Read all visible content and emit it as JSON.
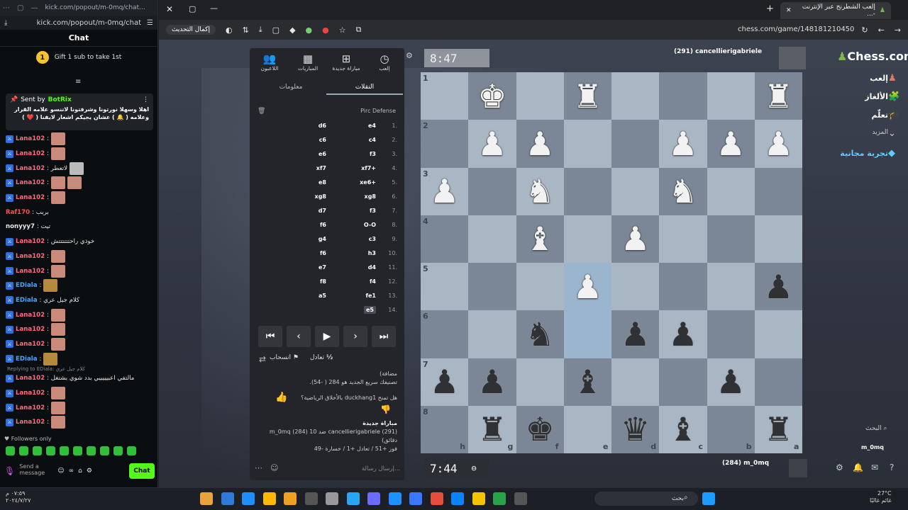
{
  "kick": {
    "url": "kick.com/popout/m-0mq/chat",
    "tab_url": "kick.com/popout/m-0mq/chat...",
    "chat_title": "Chat",
    "gift_rank": "1",
    "gift_text": "Gift 1 sub to take 1st",
    "pinned": {
      "sent_by": "Sent by",
      "author": "BotRix",
      "message": "اهلا وسهلا نورتونا وشرفتونا لاتنسو علامه القرار وعلامه ( 🔔 ) عشان يجيكم اشعار لايفنا ( ❤️ )"
    },
    "messages": [
      {
        "user": "Lana102",
        "text": ":",
        "style": "red",
        "mod": true,
        "emotes": [
          "e"
        ]
      },
      {
        "user": "Lana102",
        "text": ":",
        "style": "red",
        "mod": true,
        "emotes": [
          "e"
        ]
      },
      {
        "user": "Lana102",
        "text": ": لاتعطر",
        "style": "red",
        "mod": true,
        "emotes": [
          "g"
        ]
      },
      {
        "user": "Lana102",
        "text": ":",
        "style": "red",
        "mod": true,
        "emotes": [
          "e",
          "e"
        ]
      },
      {
        "user": "Lana102",
        "text": ":",
        "style": "red",
        "mod": true,
        "emotes": [
          "e"
        ]
      },
      {
        "user": "Raf170",
        "text": ": بربب",
        "style": "plain-red",
        "mod": false,
        "emotes": []
      },
      {
        "user": "nonyyy7",
        "text": ": تيت",
        "style": "plain",
        "mod": false,
        "emotes": []
      },
      {
        "user": "Lana102",
        "text": ": خوذي راحتتتتتتش",
        "style": "red",
        "mod": true,
        "emotes": []
      },
      {
        "user": "Lana102",
        "text": ":",
        "style": "red",
        "mod": true,
        "emotes": [
          "e"
        ]
      },
      {
        "user": "Lana102",
        "text": ":",
        "style": "red",
        "mod": true,
        "emotes": [
          "e"
        ]
      },
      {
        "user": "EDiala",
        "text": ":",
        "style": "blue",
        "mod": true,
        "emotes": [
          "o"
        ]
      },
      {
        "user": "EDiala",
        "text": ": كلام جيل عري",
        "style": "blue",
        "mod": true,
        "emotes": []
      },
      {
        "user": "Lana102",
        "text": ":",
        "style": "red",
        "mod": true,
        "emotes": [
          "e"
        ]
      },
      {
        "user": "Lana102",
        "text": ":",
        "style": "red",
        "mod": true,
        "emotes": [
          "e"
        ]
      },
      {
        "user": "Lana102",
        "text": ":",
        "style": "red",
        "mod": true,
        "emotes": [
          "e"
        ]
      },
      {
        "user": "EDiala",
        "text": ":",
        "style": "blue",
        "mod": true,
        "emotes": [
          "o"
        ]
      }
    ],
    "reply_note": "Replying to EDiala: كلام جيل عري",
    "after_reply": [
      {
        "user": "Lana102",
        "text": ": مالتفي اعبيييييي بدد شوي بشتغل",
        "style": "red",
        "mod": true,
        "emotes": []
      },
      {
        "user": "Lana102",
        "text": ":",
        "style": "red",
        "mod": true,
        "emotes": [
          "e"
        ]
      },
      {
        "user": "Lana102",
        "text": ":",
        "style": "red",
        "mod": true,
        "emotes": [
          "e"
        ]
      },
      {
        "user": "Lana102",
        "text": ":",
        "style": "red",
        "mod": true,
        "emotes": [
          "e"
        ]
      }
    ],
    "followers_only": "Followers only",
    "send_placeholder": "Send a message",
    "chat_button": "Chat"
  },
  "browser": {
    "url": "chess.com/game/148181210450",
    "tab_title": "إلعب الشطرنج عبر الإنترنت -...",
    "reload_button": "إكمال التحديث"
  },
  "game": {
    "nav": [
      {
        "label": "إلعب",
        "icon": "clock-icon"
      },
      {
        "label": "مباراة جديدة",
        "icon": "plus-icon"
      },
      {
        "label": "المباريات",
        "icon": "grid-icon"
      },
      {
        "label": "اللاعبون",
        "icon": "people-icon"
      }
    ],
    "tabs": {
      "moves": "النقلات",
      "info": "معلومات"
    },
    "opening": "Pirc Defense",
    "moves": [
      {
        "n": "1.",
        "w": "e4",
        "b": "d6"
      },
      {
        "n": "2.",
        "w": "c4",
        "b": "c6"
      },
      {
        "n": "3.",
        "w": "f3",
        "b": "e6"
      },
      {
        "n": "4.",
        "w": "xf7+",
        "b": "xf7"
      },
      {
        "n": "5.",
        "w": "xe6+",
        "b": "e8"
      },
      {
        "n": "6.",
        "w": "xg8",
        "b": "xg8"
      },
      {
        "n": "7.",
        "w": "f3",
        "b": "d7"
      },
      {
        "n": "8.",
        "w": "O-O",
        "b": "f6"
      },
      {
        "n": "9.",
        "w": "c3",
        "b": "g4"
      },
      {
        "n": "10.",
        "w": "h3",
        "b": "f6"
      },
      {
        "n": "11.",
        "w": "d4",
        "b": "e7"
      },
      {
        "n": "12.",
        "w": "f4",
        "b": "f8"
      },
      {
        "n": "13.",
        "w": "fe1",
        "b": "a5"
      },
      {
        "n": "14.",
        "w": "e5",
        "b": ""
      }
    ],
    "draw": "تعادل",
    "draw_icon": "½",
    "resign": "انسحاب",
    "rating_note_1": "مضافة)",
    "rating_note_2": "تصنيفك سريع الجديد هو 284 ( -54).",
    "question": "هل تمنح duckhang1 بالأخلاق الرياضية؟",
    "new_game_title": "مباراة جديدة",
    "new_game_desc": "cancellierigabriele (291) ضد m_0mq (284) 10 دقائق)",
    "record": "فوز +51 / تعادل +1 / خسارة -49",
    "message_placeholder": "إرسال رسالة...",
    "clock_top": "8:47",
    "clock_bottom": "7:44",
    "opponent": "(291) cancellierigabriele",
    "me": "(284) m_0mq"
  },
  "sidebar": {
    "logo": "Chess.com",
    "items": [
      "إلعب",
      "الألغاز",
      "تعلّم",
      "المزيد",
      "تجربة مجانية"
    ],
    "search": "البحث",
    "user": "m_0mq"
  },
  "taskbar": {
    "search": "بحث",
    "time": "٠٧:٥٩ م",
    "date": "٢٠٢٤/٧/٢٧",
    "temp": "27°C",
    "weather": "غائم غالبًا"
  },
  "colors": {
    "kick_green": "#53fc18",
    "chess_green": "#81b64c"
  }
}
